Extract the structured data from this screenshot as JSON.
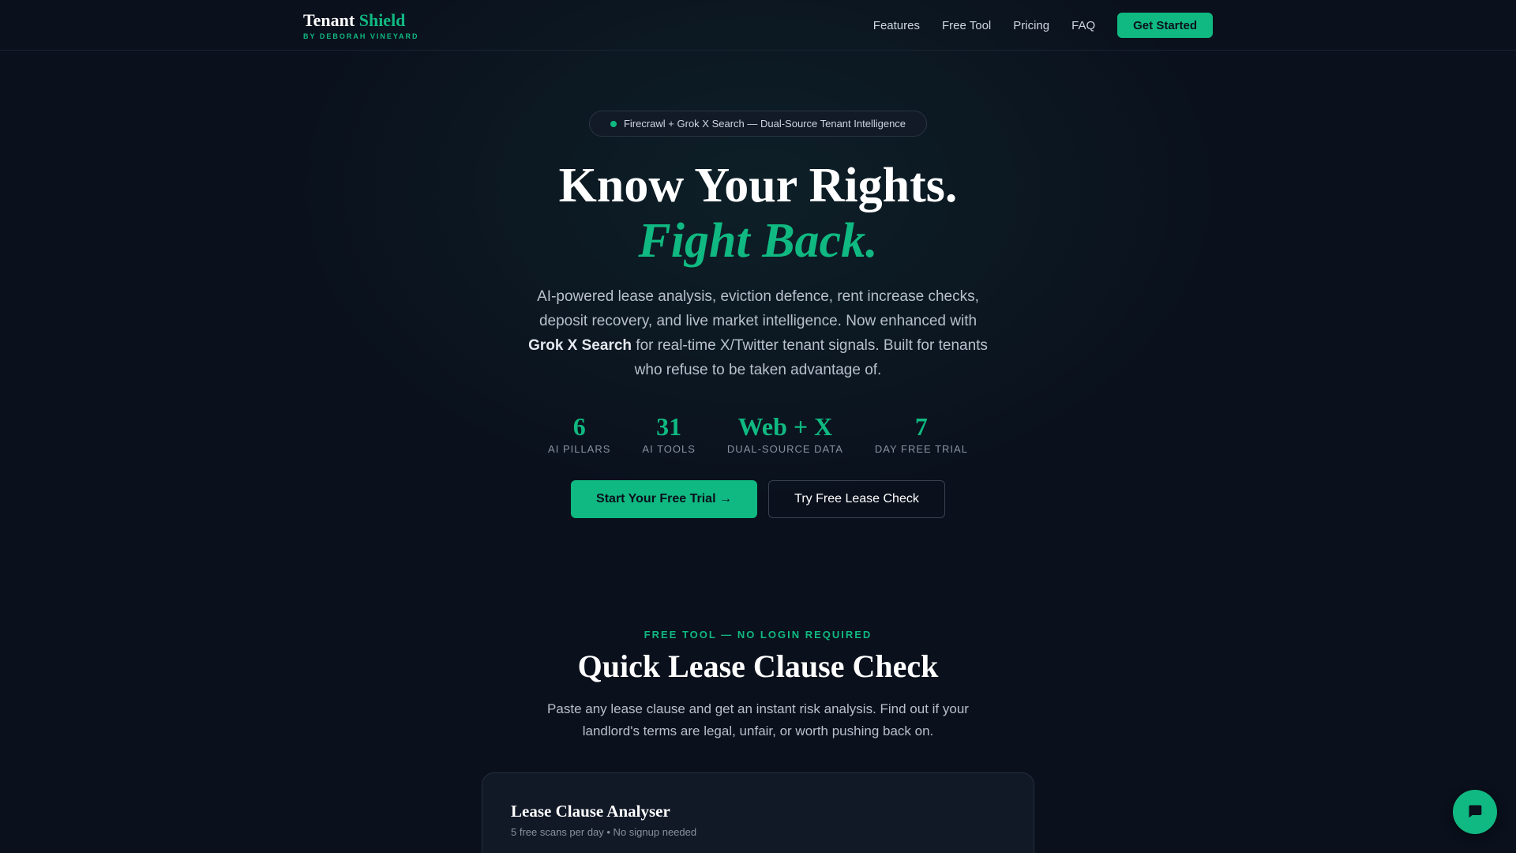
{
  "brand": {
    "title_part1": "Tenant",
    "title_part2": "Shield",
    "subtitle": "BY DEBORAH VINEYARD"
  },
  "nav": {
    "links": [
      "Features",
      "Free Tool",
      "Pricing",
      "FAQ"
    ],
    "cta": "Get Started"
  },
  "hero": {
    "badge": "Firecrawl + Grok X Search — Dual-Source Tenant Intelligence",
    "title_line1": "Know Your Rights.",
    "title_line2": "Fight Back.",
    "desc_part1": "AI-powered lease analysis, eviction defence, rent increase checks, deposit recovery, and live market intelligence. Now enhanced with ",
    "desc_bold": "Grok X Search",
    "desc_part2": " for real-time X/Twitter tenant signals. Built for tenants who refuse to be taken advantage of.",
    "stats": [
      {
        "value": "6",
        "label": "AI PILLARS"
      },
      {
        "value": "31",
        "label": "AI TOOLS"
      },
      {
        "value": "Web + X",
        "label": "DUAL-SOURCE DATA"
      },
      {
        "value": "7",
        "label": "DAY FREE TRIAL"
      }
    ],
    "primary_cta": "Start Your Free Trial →",
    "secondary_cta": "Try Free Lease Check"
  },
  "free_tool": {
    "eyebrow": "FREE TOOL — NO LOGIN REQUIRED",
    "title": "Quick Lease Clause Check",
    "desc": "Paste any lease clause and get an instant risk analysis. Find out if your landlord's terms are legal, unfair, or worth pushing back on.",
    "card_title": "Lease Clause Analyser",
    "card_sub": "5 free scans per day • No signup needed"
  },
  "icons": {
    "chat": "chat-bubble-icon",
    "badge_dot": "status-dot-icon"
  },
  "colors": {
    "background": "#0a101c",
    "accent": "#10b981",
    "text_muted": "#b8c0cc"
  }
}
